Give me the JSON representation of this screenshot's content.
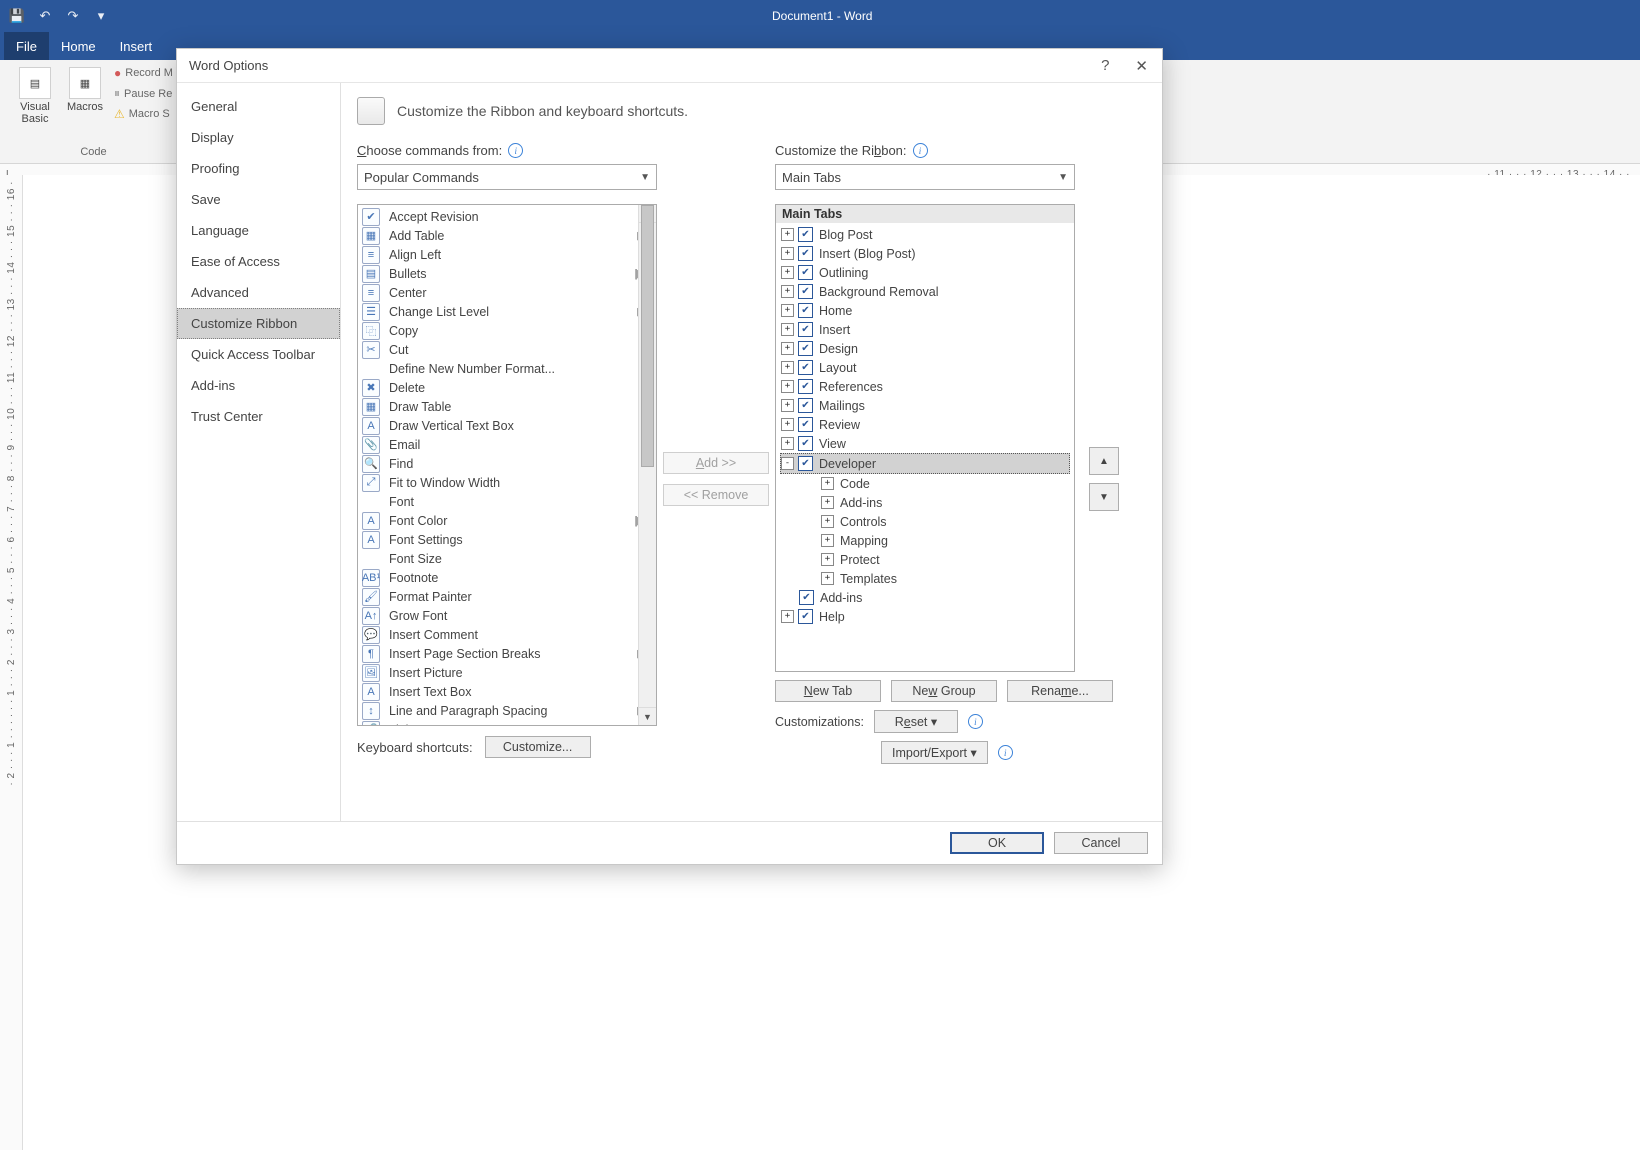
{
  "titlebar": {
    "title": "Document1 - Word",
    "save_tip": "Save",
    "undo_tip": "Undo",
    "redo_tip": "Redo"
  },
  "tabs": [
    "File",
    "Home",
    "Insert"
  ],
  "ribbon": {
    "visual_basic": "Visual Basic",
    "macros": "Macros",
    "record": "Record M",
    "pause": "Pause Re",
    "macro_sec": "Macro S",
    "group_code": "Code"
  },
  "ruler_left_marker": "L",
  "ruler_right": "· 11 · · · 12 · · · 13 · · · 14 · ·",
  "vruler": "· 2 · · · 1 · · ·   · · · 1 · · · 2 · · · 3 · · · 4 · · · 5 · · · 6 · · · 7 · · · 8 · · · 9 · · · 10 · · · 11 · · · 12 · · · 13 · · · 14 · · · 15 · · · 16 ·",
  "dialog": {
    "title": "Word Options",
    "help_tip": "Help",
    "close_tip": "Close",
    "nav": [
      "General",
      "Display",
      "Proofing",
      "Save",
      "Language",
      "Ease of Access",
      "Advanced",
      "Customize Ribbon",
      "Quick Access Toolbar",
      "Add-ins",
      "Trust Center"
    ],
    "nav_selected": "Customize Ribbon",
    "heading": "Customize the Ribbon and keyboard shortcuts.",
    "choose_label": "Choose commands from:",
    "choose_value": "Popular Commands",
    "customize_label": "Customize the Ribbon:",
    "customize_value": "Main Tabs",
    "commands": [
      {
        "icon": "check",
        "label": "Accept Revision"
      },
      {
        "icon": "table",
        "label": "Add Table",
        "more": true
      },
      {
        "icon": "alignl",
        "label": "Align Left"
      },
      {
        "icon": "bullets",
        "label": "Bullets",
        "more": "split"
      },
      {
        "icon": "center",
        "label": "Center"
      },
      {
        "icon": "list",
        "label": "Change List Level",
        "more": true
      },
      {
        "icon": "copy",
        "label": "Copy"
      },
      {
        "icon": "cut",
        "label": "Cut"
      },
      {
        "icon": "blank",
        "label": "Define New Number Format..."
      },
      {
        "icon": "x",
        "label": "Delete"
      },
      {
        "icon": "table",
        "label": "Draw Table"
      },
      {
        "icon": "textbox",
        "label": "Draw Vertical Text Box"
      },
      {
        "icon": "clip",
        "label": "Email"
      },
      {
        "icon": "find",
        "label": "Find"
      },
      {
        "icon": "fit",
        "label": "Fit to Window Width"
      },
      {
        "icon": "blank",
        "label": "Font",
        "more": "edit"
      },
      {
        "icon": "A",
        "label": "Font Color",
        "more": "split"
      },
      {
        "icon": "A",
        "label": "Font Settings"
      },
      {
        "icon": "blank",
        "label": "Font Size",
        "more": "edit"
      },
      {
        "icon": "AB1",
        "label": "Footnote"
      },
      {
        "icon": "brush",
        "label": "Format Painter"
      },
      {
        "icon": "Aup",
        "label": "Grow Font"
      },
      {
        "icon": "comment",
        "label": "Insert Comment"
      },
      {
        "icon": "break",
        "label": "Insert Page  Section Breaks",
        "more": true
      },
      {
        "icon": "pic",
        "label": "Insert Picture"
      },
      {
        "icon": "textbox",
        "label": "Insert Text Box"
      },
      {
        "icon": "lspace",
        "label": "Line and Paragraph Spacing",
        "more": true
      },
      {
        "icon": "link",
        "label": "Link"
      }
    ],
    "tree_header": "Main Tabs",
    "tree": [
      {
        "exp": "+",
        "chk": true,
        "label": "Blog Post"
      },
      {
        "exp": "+",
        "chk": true,
        "label": "Insert (Blog Post)"
      },
      {
        "exp": "+",
        "chk": true,
        "label": "Outlining"
      },
      {
        "exp": "+",
        "chk": true,
        "label": "Background Removal"
      },
      {
        "exp": "+",
        "chk": true,
        "label": "Home"
      },
      {
        "exp": "+",
        "chk": true,
        "label": "Insert"
      },
      {
        "exp": "+",
        "chk": true,
        "label": "Design"
      },
      {
        "exp": "+",
        "chk": true,
        "label": "Layout"
      },
      {
        "exp": "+",
        "chk": true,
        "label": "References"
      },
      {
        "exp": "+",
        "chk": true,
        "label": "Mailings"
      },
      {
        "exp": "+",
        "chk": true,
        "label": "Review"
      },
      {
        "exp": "+",
        "chk": true,
        "label": "View"
      },
      {
        "exp": "-",
        "chk": true,
        "label": "Developer",
        "selected": true
      }
    ],
    "dev_children": [
      "Code",
      "Add-ins",
      "Controls",
      "Mapping",
      "Protect",
      "Templates"
    ],
    "addins_row": {
      "chk": true,
      "label": "Add-ins"
    },
    "help_row": {
      "exp": "+",
      "chk": true,
      "label": "Help"
    },
    "buttons": {
      "add": "Add >>",
      "remove": "<< Remove",
      "new_tab": "New Tab",
      "new_group": "New Group",
      "rename": "Rename...",
      "reset": "Reset ▾",
      "import_export": "Import/Export ▾",
      "customize": "Customize...",
      "ok": "OK",
      "cancel": "Cancel"
    },
    "labels": {
      "customizations": "Customizations:",
      "keyboard_shortcuts": "Keyboard shortcuts:",
      "up_tip": "Move Up",
      "down_tip": "Move Down"
    }
  }
}
